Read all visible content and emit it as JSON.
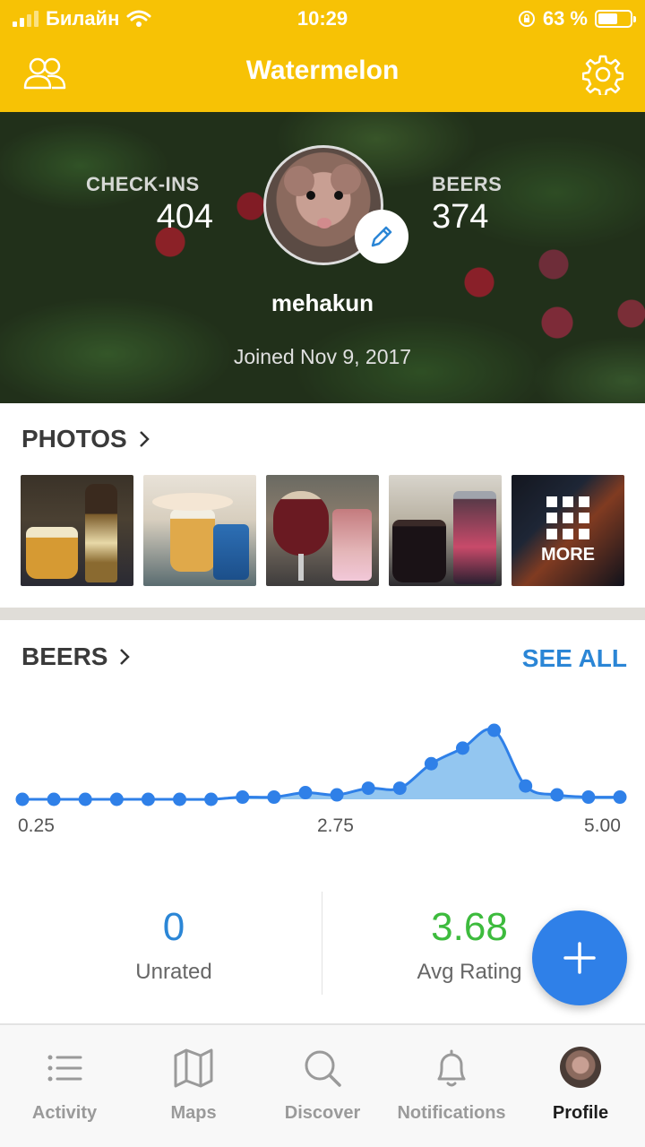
{
  "status_bar": {
    "carrier": "Билайн",
    "time": "10:29",
    "battery": "63 %",
    "battery_level": 0.63
  },
  "nav": {
    "title": "Watermelon",
    "left_icon": "friends-icon",
    "right_icon": "gear-icon"
  },
  "profile": {
    "checkins_label": "CHECK-INS",
    "checkins_value": "404",
    "beers_label": "BEERS",
    "beers_value": "374",
    "username": "mehakun",
    "joined": "Joined Nov 9, 2017"
  },
  "photos": {
    "title": "PHOTOS",
    "more_label": "MORE",
    "count": 5
  },
  "beers_section": {
    "title": "BEERS",
    "see_all": "SEE ALL"
  },
  "chart_data": {
    "type": "area",
    "x": [
      0.25,
      0.5,
      0.75,
      1.0,
      1.25,
      1.5,
      1.75,
      2.0,
      2.25,
      2.5,
      2.75,
      3.0,
      3.25,
      3.5,
      3.75,
      4.0,
      4.25,
      4.5,
      4.75,
      5.0
    ],
    "values": [
      0,
      0,
      0,
      0,
      0,
      0,
      0,
      1,
      1,
      3,
      2,
      5,
      5,
      16,
      23,
      31,
      6,
      2,
      1,
      1
    ],
    "tick_labels": [
      "0.25",
      "2.75",
      "5.00"
    ],
    "accent": "#2f80e8",
    "fill": "#93c6f0"
  },
  "stats": {
    "unrated_value": "0",
    "unrated_label": "Unrated",
    "avg_value": "3.68",
    "avg_label": "Avg Rating",
    "unrated_color": "#2b86d6",
    "avg_color": "#3dbb3d"
  },
  "tabs": [
    {
      "label": "Activity",
      "icon": "list-icon"
    },
    {
      "label": "Maps",
      "icon": "map-icon"
    },
    {
      "label": "Discover",
      "icon": "search-icon"
    },
    {
      "label": "Notifications",
      "icon": "bell-icon"
    },
    {
      "label": "Profile",
      "icon": "avatar"
    }
  ],
  "colors": {
    "brand_yellow": "#f7c205",
    "link_blue": "#2b86d6"
  }
}
